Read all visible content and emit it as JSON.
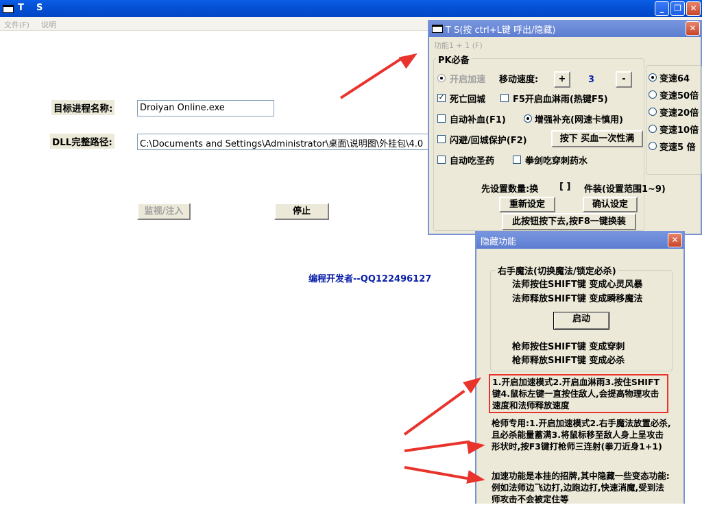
{
  "main_window": {
    "title": "T    S",
    "menu": [
      "文件(F)",
      "说明"
    ],
    "process_label": "目标进程名称:",
    "process_value": "Droiyan Online.exe",
    "dll_label": "DLL完整路径:",
    "dll_value": "C:\\Documents and Settings\\Administrator\\桌面\\说明图\\外挂包\\4.0",
    "monitor_button": "监视/注入",
    "stop_button": "停止",
    "developer": "编程开发者--QQ122496127"
  },
  "ts_window": {
    "title": "T S(按 ctrl+L键 呼出/隐藏)",
    "menu": "功能1 + 1 (F)",
    "group_title": "PK必备",
    "accel_label": "开启加速",
    "speed_label": "移动速度:",
    "plus": "+",
    "speed_value": "3",
    "minus": "-",
    "death_return": "死亡回城",
    "f5_blood_rain": "F5开启血淋雨(热键F5)",
    "auto_heal": "自动补血(F1)",
    "enhanced_heal": "增强补充(网速卡慎用)",
    "dodge_protect": "闪避/回城保护(F2)",
    "buy_blood_button": "按下 买血一次性满",
    "auto_holy_pill": "自动吃圣药",
    "fist_sword_potion": "拳剑吃穿刺药水",
    "speed_options": [
      "变速64",
      "变速50倍",
      "变速20倍",
      "变速10倍",
      "变速5 倍"
    ],
    "set_count_prefix": "先设置数量:换",
    "set_count_bracket": "[ ]",
    "set_count_suffix": "件装(设置范围1~9)",
    "reset_button": "重新设定",
    "confirm_button": "确认设定",
    "f8_button": "此按钮按下去,按F8一键换装"
  },
  "hide_window": {
    "title": "隐藏功能",
    "group_title": "右手魔法(切换魔法/锁定必杀)",
    "line1": "法师按住SHIFT键 变成心灵风暴",
    "line2": "法师释放SHIFT键 变成瞬移魔法",
    "start_button": "启动",
    "line3": "枪师按住SHIFT键 变成穿刺",
    "line4": "枪师释放SHIFT键 变成必杀",
    "note1": "1.开启加速模式2.开启血淋雨3.按住SHIFT键4.鼠标左键一直按住敌人,会提高物理攻击速度和法师释放速度",
    "note2": "枪师专用:1.开启加速模式2.右手魔法放置必杀,且必杀能量蓄满3.将鼠标移至敌人身上呈攻击形状时,按F3键打枪师三连射(拳刀近身1+1)",
    "note3": "加速功能是本挂的招牌,其中隐藏一些变态功能:例如法师边飞边打,边跑边打,快速消魔,受到法师攻击不会被定住等"
  },
  "colors": {
    "title_blue": "#0551d6",
    "panel": "#ece9d8",
    "annotation_red": "#e8342c",
    "developer_blue": "#0a1fa8"
  }
}
